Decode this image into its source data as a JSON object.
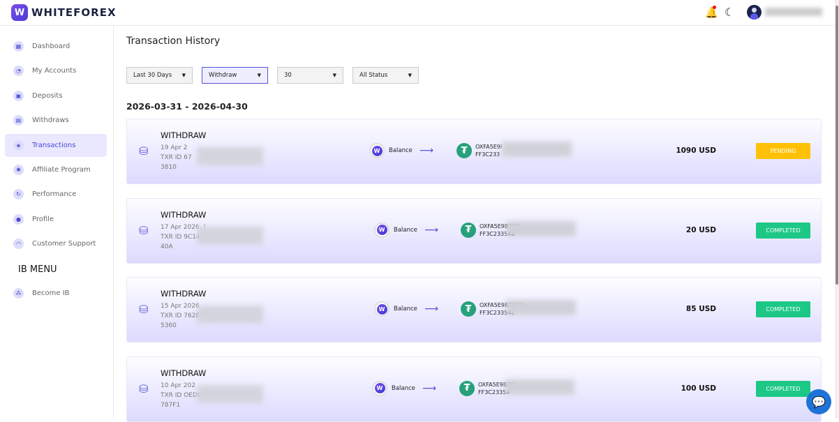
{
  "brand": {
    "logo_letter": "W",
    "name": "WHITEFOREX"
  },
  "header": {
    "bell_icon": "🔔",
    "moon_icon": "☾"
  },
  "sidebar": {
    "items": [
      {
        "label": "Dashboard",
        "icon": "▦"
      },
      {
        "label": "My Accounts",
        "icon": "◔"
      },
      {
        "label": "Deposits",
        "icon": "▣"
      },
      {
        "label": "Withdraws",
        "icon": "▤"
      },
      {
        "label": "Transactions",
        "icon": "◈"
      },
      {
        "label": "Affiliate Program",
        "icon": "✺"
      },
      {
        "label": "Performance",
        "icon": "↻"
      },
      {
        "label": "Profile",
        "icon": "●"
      },
      {
        "label": "Customer Support",
        "icon": "◠"
      }
    ],
    "ib_menu": "IB MENU",
    "ib_items": [
      {
        "label": "Become IB",
        "icon": "⁂"
      }
    ]
  },
  "main": {
    "title": "Transaction History",
    "filters": [
      {
        "value": "Last 30 Days"
      },
      {
        "value": "Withdraw"
      },
      {
        "value": "30"
      },
      {
        "value": "All Status"
      }
    ],
    "range": "2026-03-31 - 2026-04-30",
    "transactions": [
      {
        "type": "WITHDRAW",
        "date": "19 Apr 2",
        "txr": "TXR ID 67",
        "tail": "3810",
        "from": "Balance",
        "addr1": "OXFA5E9I",
        "addr2": "FF3C233",
        "amount": "1090 USD",
        "status": "PENDING",
        "status_color": "#ffc107"
      },
      {
        "type": "WITHDRAW",
        "date": "17 Apr 2026, !",
        "txr": "TXR ID 9C14A1",
        "tail": "40A",
        "from": "Balance",
        "addr1": "OXFA5E9B7EEI",
        "addr2": "FF3C23354B",
        "amount": "20 USD",
        "status": "COMPLETED",
        "status_color": "#1dc886"
      },
      {
        "type": "WITHDRAW",
        "date": "15 Apr 2026",
        "txr": "TXR ID 762EE2",
        "tail": "5360",
        "from": "Balance",
        "addr1": "OXFA5E9B7EEB",
        "addr2": "FF3C23354E",
        "amount": "85 USD",
        "status": "COMPLETED",
        "status_color": "#1dc886"
      },
      {
        "type": "WITHDRAW",
        "date": "10 Apr 202",
        "txr": "TXR ID OEDD",
        "tail": "787F1",
        "from": "Balance",
        "addr1": "OXFA5E9B7EI",
        "addr2": "FF3C23354",
        "amount": "100 USD",
        "status": "COMPLETED",
        "status_color": "#1dc886"
      }
    ]
  },
  "chat_icon": "💬"
}
